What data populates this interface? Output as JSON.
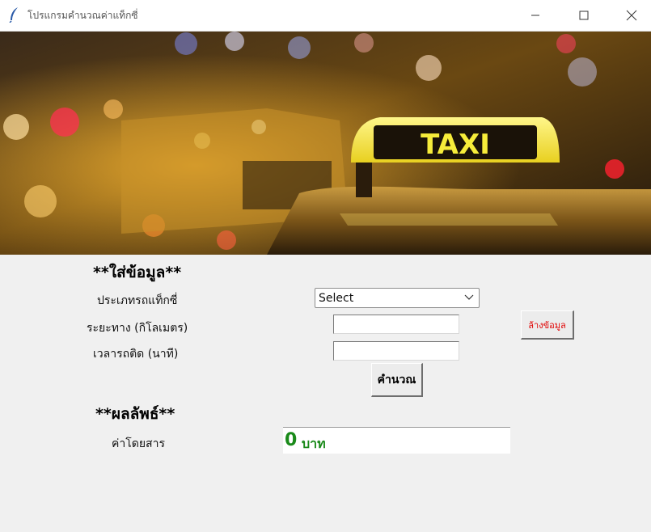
{
  "window": {
    "title": "โปรแกรมคำนวณค่าแท็กซี่",
    "app_icon": "feather-icon",
    "controls": {
      "minimize": "minimize-icon",
      "maximize": "maximize-icon",
      "close": "close-icon"
    }
  },
  "banner": {
    "sign_text": "TAXI",
    "colors": {
      "sign": "#f2e62a",
      "dark": "#1a1208",
      "glow": "#e0a020"
    }
  },
  "form": {
    "heading": "**ใส่ข้อมูล**",
    "taxi_type_label": "ประเภทรถแท็กซี่",
    "taxi_type_value": "Select",
    "distance_label": "ระยะทาง (กิโลเมตร)",
    "distance_value": "",
    "traffic_label": "เวลารถติด (นาที)",
    "traffic_value": "",
    "clear_button": "ล้างข้อมูล",
    "calc_button": "คำนวณ"
  },
  "result": {
    "heading": "**ผลลัพธ์**",
    "fare_label": "ค่าโดยสาร",
    "fare_value": "0",
    "fare_unit": "บาท",
    "color": "#1a8a1a"
  }
}
